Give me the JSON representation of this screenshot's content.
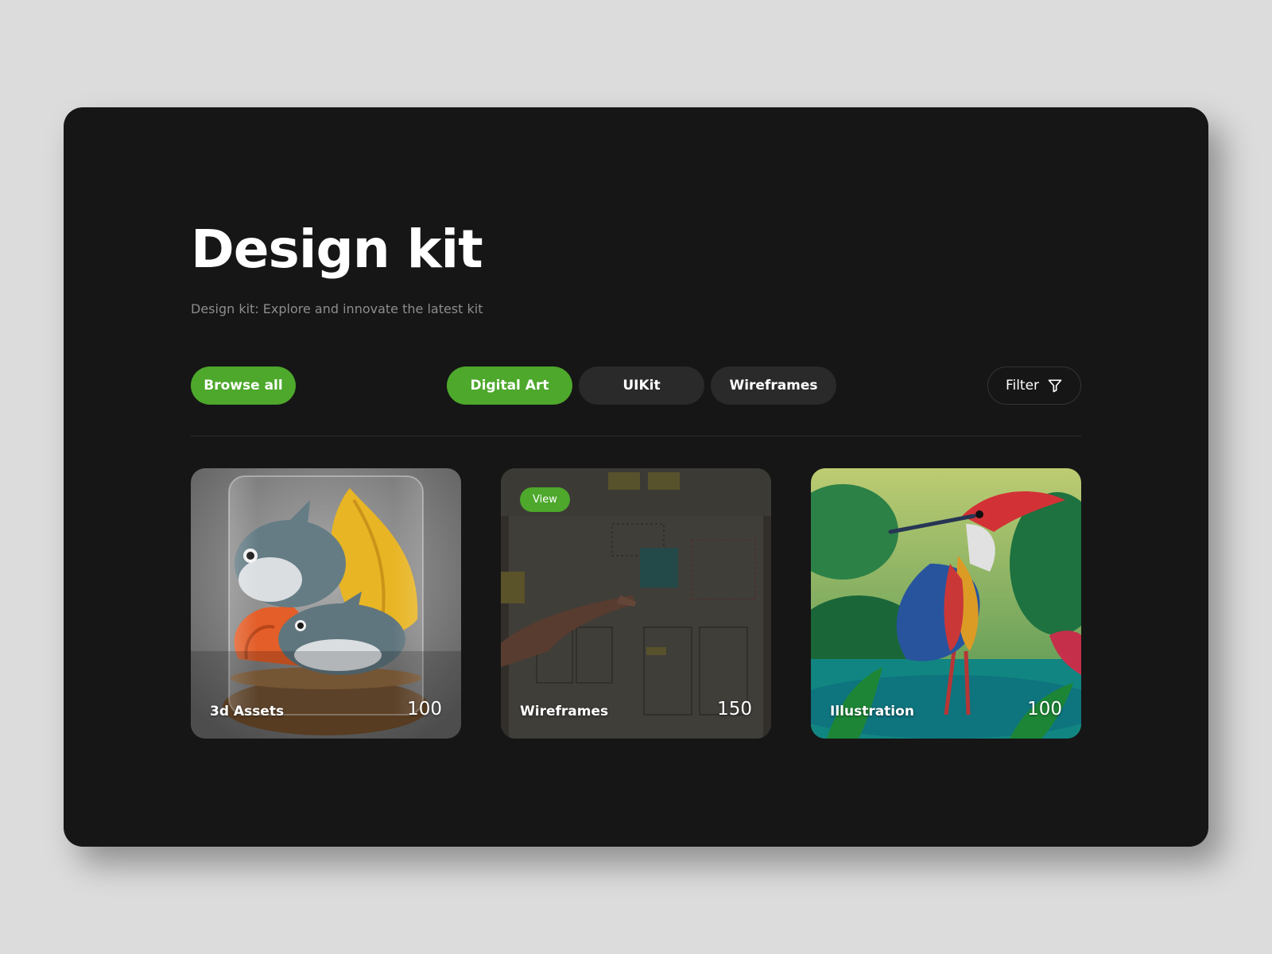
{
  "header": {
    "title": "Design kit",
    "subtitle": "Design kit: Explore and innovate the latest kit"
  },
  "toolbar": {
    "browse_label": "Browse all",
    "tabs": [
      {
        "label": "Digital Art",
        "active": true
      },
      {
        "label": "UIKit",
        "active": false
      },
      {
        "label": "Wireframes",
        "active": false
      }
    ],
    "filter_label": "Filter",
    "filter_icon": "filter-funnel-icon"
  },
  "cards": [
    {
      "label": "3d Assets",
      "count": "100",
      "image": "3d-birds-in-glass-jar"
    },
    {
      "label": "Wireframes",
      "count": "150",
      "image": "wireframe-whiteboard-photo",
      "badge": "View"
    },
    {
      "label": "Illustration",
      "count": "100",
      "image": "jungle-heron-illustration"
    }
  ],
  "colors": {
    "accent": "#4da82c",
    "panel_bg": "#161616",
    "page_bg": "#dcdcdc",
    "tab_inactive": "#2a2a2a"
  }
}
